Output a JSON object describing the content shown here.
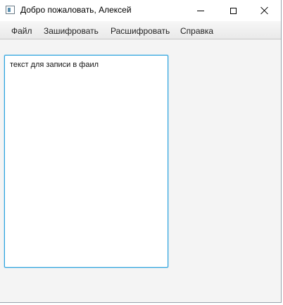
{
  "window": {
    "title": "Добро пожаловать, Алексей"
  },
  "titlebar_icons": {
    "app": "app-window-icon",
    "minimize": "minimize-icon",
    "maximize": "maximize-icon",
    "close": "close-icon"
  },
  "menubar": {
    "items": [
      {
        "label": "Файл"
      },
      {
        "label": "Зашифровать"
      },
      {
        "label": "Расшифровать"
      },
      {
        "label": "Справка"
      }
    ]
  },
  "editor": {
    "value": "текст для записи в фаил"
  },
  "colors": {
    "focus_border": "#2aa2de",
    "window_background": "#f4f4f4"
  }
}
